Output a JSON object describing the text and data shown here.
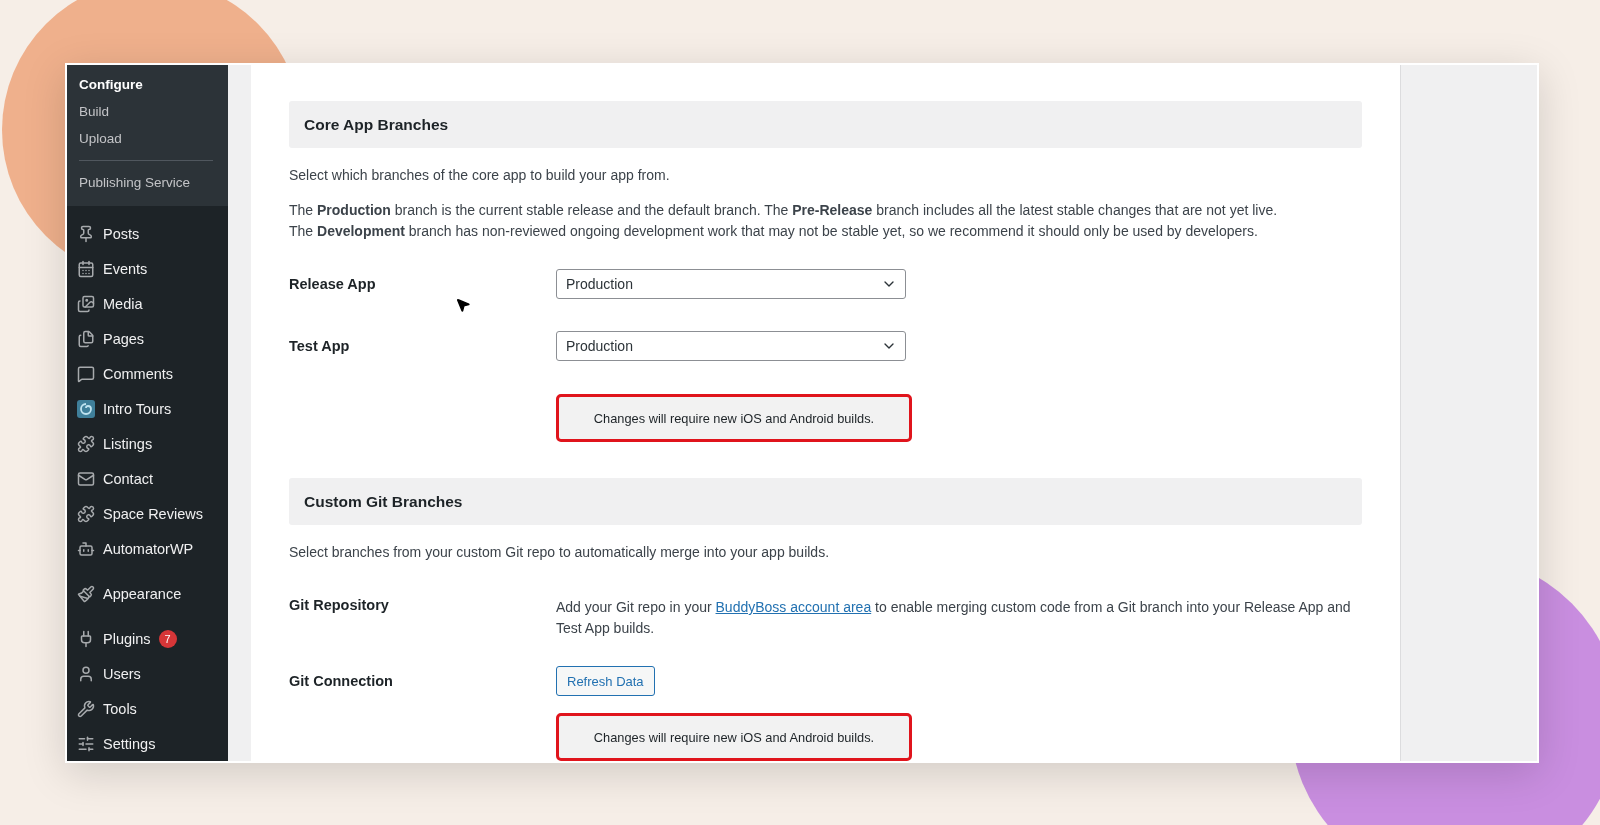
{
  "sidebar": {
    "submenu": [
      {
        "label": "Configure",
        "selected": true
      },
      {
        "label": "Build",
        "selected": false
      },
      {
        "label": "Upload",
        "selected": false
      },
      {
        "label": "Publishing Service",
        "selected": false,
        "divider_before": true
      }
    ],
    "items": [
      {
        "label": "Posts"
      },
      {
        "label": "Events"
      },
      {
        "label": "Media"
      },
      {
        "label": "Pages"
      },
      {
        "label": "Comments"
      },
      {
        "label": "Intro Tours"
      },
      {
        "label": "Listings"
      },
      {
        "label": "Contact"
      },
      {
        "label": "Space Reviews"
      },
      {
        "label": "AutomatorWP"
      },
      {
        "label": "Appearance",
        "gap_before": true
      },
      {
        "label": "Plugins",
        "badge": "7",
        "gap_before": true
      },
      {
        "label": "Users"
      },
      {
        "label": "Tools"
      },
      {
        "label": "Settings"
      }
    ]
  },
  "sections": [
    {
      "title": "Core App Branches",
      "description": "Select which branches of the core app to build your app from.",
      "note": [
        "The **Production** branch is the current stable release and the default branch. The **Pre-Release** branch includes all the latest stable changes that are not yet live.",
        "The **Development** branch has non-reviewed ongoing development work that may not be stable yet, so we recommend it should only be used by developers."
      ],
      "rows": [
        {
          "kind": "select",
          "label": "Release App",
          "value": "Production"
        },
        {
          "kind": "select",
          "label": "Test App",
          "value": "Production"
        },
        {
          "kind": "notice",
          "text": "Changes will require new iOS and Android builds.",
          "highlighted": true
        }
      ]
    },
    {
      "title": "Custom Git Branches",
      "description": "Select branches from your custom Git repo to automatically merge into your app builds.",
      "rows": [
        {
          "kind": "text",
          "label": "Git Repository",
          "before": "Add your Git repo in your ",
          "link": "BuddyBoss account area",
          "after": " to enable merging custom code from a Git branch into your Release App and Test App builds."
        },
        {
          "kind": "button",
          "label": "Git Connection",
          "button": "Refresh Data"
        },
        {
          "kind": "notice",
          "text": "Changes will require new iOS and Android builds.",
          "highlighted": true
        }
      ]
    }
  ]
}
